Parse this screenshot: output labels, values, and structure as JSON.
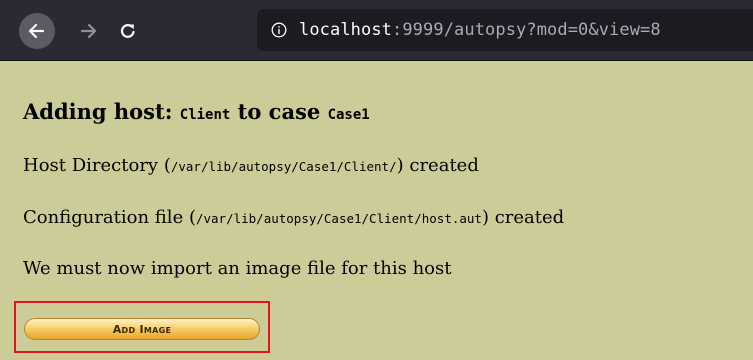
{
  "browser": {
    "url_prefix": "",
    "url_host": "localhost",
    "url_rest": ":9999/autopsy?mod=0&view=8",
    "icons": {
      "back": "arrow-left-icon",
      "forward": "arrow-right-icon",
      "reload": "reload-icon",
      "info": "info-circle-icon"
    }
  },
  "page": {
    "heading": {
      "prefix": "Adding host: ",
      "host": "Client",
      "middle": " to case ",
      "case": "Case1"
    },
    "lines": [
      {
        "before": "Host Directory (",
        "path": "/var/lib/autopsy/Case1/Client/",
        "after": ") created"
      },
      {
        "before": "Configuration file (",
        "path": "/var/lib/autopsy/Case1/Client/host.aut",
        "after": ") created"
      }
    ],
    "import_message": "We must now import an image file for this host",
    "add_image_button": "Add Image"
  },
  "colors": {
    "page_background": "#cccc99",
    "toolbar_background": "#2b2a33",
    "highlight_border": "#e4141b"
  }
}
